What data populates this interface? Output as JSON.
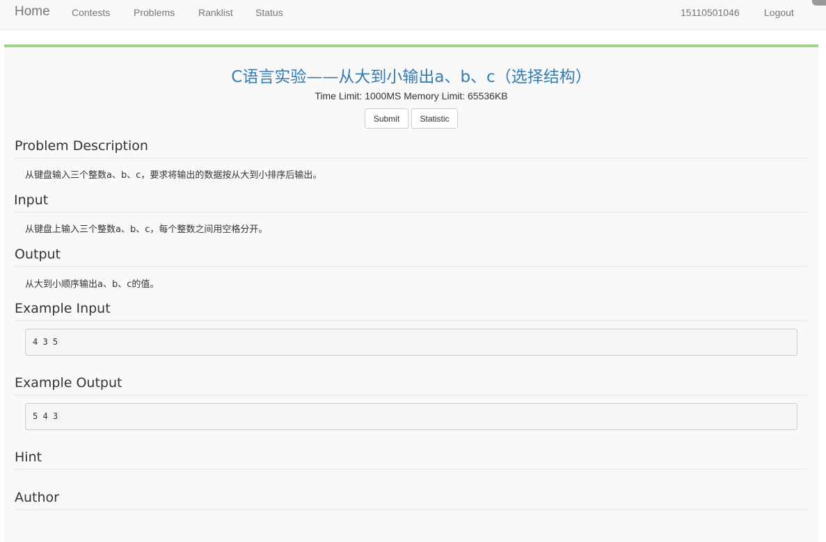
{
  "nav": {
    "brand": "Home",
    "links": [
      "Contests",
      "Problems",
      "Ranklist",
      "Status"
    ],
    "user": "15110501046",
    "logout": "Logout"
  },
  "problem": {
    "title": "C语言实验——从大到小输出a、b、c（选择结构）",
    "limits": "Time Limit: 1000MS Memory Limit: 65536KB",
    "buttons": {
      "submit": "Submit",
      "statistic": "Statistic"
    },
    "sections": {
      "description": {
        "heading": "Problem Description",
        "text": "从键盘输入三个整数a、b、c，要求将输出的数据按从大到小排序后输出。"
      },
      "input": {
        "heading": "Input",
        "text": "从键盘上输入三个整数a、b、c，每个整数之间用空格分开。"
      },
      "output": {
        "heading": "Output",
        "text": "从大到小顺序输出a、b、c的值。"
      },
      "example_input": {
        "heading": "Example Input",
        "code": "4 3 5"
      },
      "example_output": {
        "heading": "Example Output",
        "code": "5 4 3"
      },
      "hint": {
        "heading": "Hint"
      },
      "author": {
        "heading": "Author"
      }
    }
  },
  "colors": {
    "title": "#337ab7",
    "accent_bar": "#9ed58c",
    "nav_text": "#777777"
  }
}
